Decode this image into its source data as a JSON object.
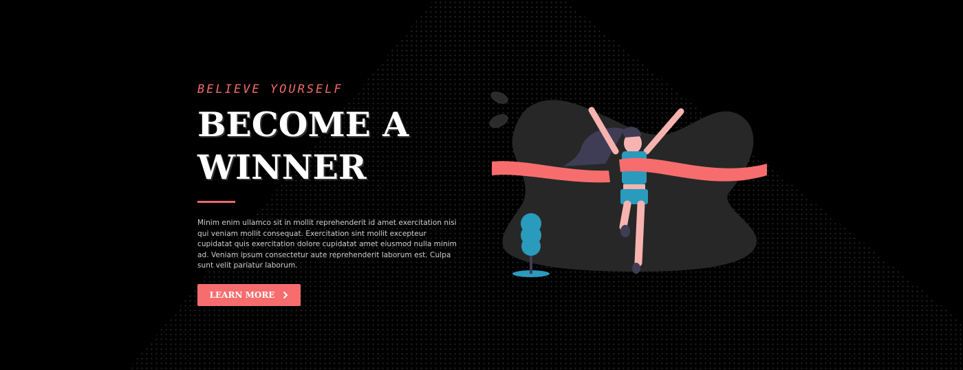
{
  "hero": {
    "eyebrow": "BELIEVE YOURSELF",
    "title_line1": "BECOME A",
    "title_line2": "WINNER",
    "body": "Minim enim ullamco sit in mollit reprehenderit id amet exercitation nisi qui veniam mollit consequat. Exercitation sint mollit excepteur cupidatat quis exercitation dolore cupidatat amet eiusmod nulla minim ad. Veniam ipsum consectetur aute reprehenderit laborum est. Culpa sunt velit pariatur laborum.",
    "button_label": "LEARN MORE",
    "button_icon": "chevron-right-icon"
  },
  "colors": {
    "accent": "#f76d6d",
    "background": "#000000",
    "blob": "#272727",
    "teal": "#2a9bbd",
    "skin": "#f7b3b0",
    "hair": "#3f3d56"
  }
}
